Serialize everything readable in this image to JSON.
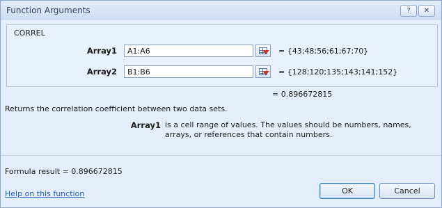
{
  "window": {
    "title": "Function Arguments",
    "help_symbol": "?",
    "close_symbol": "✕"
  },
  "function": {
    "name": "CORREL",
    "args": [
      {
        "label": "Array1",
        "input": "A1:A6",
        "value": "= {43;48;56;61;67;70}"
      },
      {
        "label": "Array2",
        "input": "B1:B6",
        "value": "= {128;120;135;143;141;152}"
      }
    ],
    "result": "= 0.896672815",
    "description": "Returns the correlation coefficient between two data sets.",
    "arg_desc_name": "Array1",
    "arg_desc_text": "is a cell range of values. The values should be numbers, names, arrays, or references that contain numbers."
  },
  "footer": {
    "formula_result": "Formula result =  0.896672815",
    "help_link": "Help on this function",
    "ok_label": "OK",
    "cancel_label": "Cancel"
  }
}
